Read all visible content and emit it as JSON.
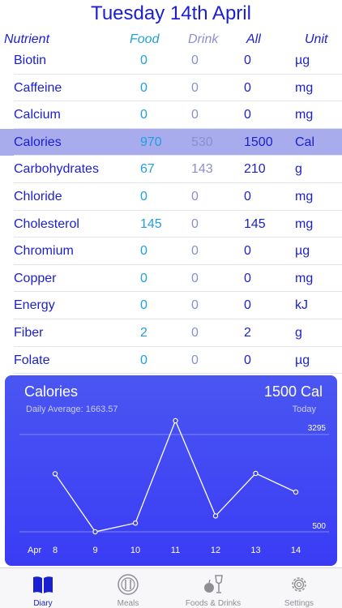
{
  "header": {
    "title": "Tuesday 14th April"
  },
  "columns": {
    "nutrient": "Nutrient",
    "food": "Food",
    "drink": "Drink",
    "all": "All",
    "unit": "Unit"
  },
  "rows": [
    {
      "name": "Biotin",
      "food": "0",
      "drink": "0",
      "all": "0",
      "unit": "µg"
    },
    {
      "name": "Caffeine",
      "food": "0",
      "drink": "0",
      "all": "0",
      "unit": "mg"
    },
    {
      "name": "Calcium",
      "food": "0",
      "drink": "0",
      "all": "0",
      "unit": "mg"
    },
    {
      "name": "Calories",
      "food": "970",
      "drink": "530",
      "all": "1500",
      "unit": "Cal",
      "selected": true
    },
    {
      "name": "Carbohydrates",
      "food": "67",
      "drink": "143",
      "all": "210",
      "unit": "g"
    },
    {
      "name": "Chloride",
      "food": "0",
      "drink": "0",
      "all": "0",
      "unit": "mg"
    },
    {
      "name": "Cholesterol",
      "food": "145",
      "drink": "0",
      "all": "145",
      "unit": "mg"
    },
    {
      "name": "Chromium",
      "food": "0",
      "drink": "0",
      "all": "0",
      "unit": "µg"
    },
    {
      "name": "Copper",
      "food": "0",
      "drink": "0",
      "all": "0",
      "unit": "mg"
    },
    {
      "name": "Energy",
      "food": "0",
      "drink": "0",
      "all": "0",
      "unit": "kJ"
    },
    {
      "name": "Fiber",
      "food": "2",
      "drink": "0",
      "all": "2",
      "unit": "g"
    },
    {
      "name": "Folate",
      "food": "0",
      "drink": "0",
      "all": "0",
      "unit": "µg"
    }
  ],
  "chart_panel": {
    "title": "Calories",
    "total": "1500 Cal",
    "daily_average": "Daily Average: 1663.57",
    "today_label": "Today"
  },
  "chart_data": {
    "type": "line",
    "x_prefix": "Apr",
    "x": [
      "8",
      "9",
      "10",
      "11",
      "12",
      "13",
      "14"
    ],
    "values": [
      1960,
      500,
      720,
      3295,
      900,
      1970,
      1500
    ],
    "ylim": [
      500,
      3295
    ],
    "y_ticks": [
      "3295",
      "500"
    ],
    "grid": true
  },
  "tabs": [
    {
      "label": "Diary",
      "icon": "book-icon",
      "active": true
    },
    {
      "label": "Meals",
      "icon": "plate-icon",
      "active": false
    },
    {
      "label": "Foods & Drinks",
      "icon": "food-drink-icon",
      "active": false
    },
    {
      "label": "Settings",
      "icon": "gear-icon",
      "active": false
    }
  ],
  "colors": {
    "accent": "#1a1fd0",
    "food": "#1f9fe0",
    "drink": "#8a8fd0",
    "selected_row": "#a9acec",
    "chart_bg": "#3d42f3"
  }
}
